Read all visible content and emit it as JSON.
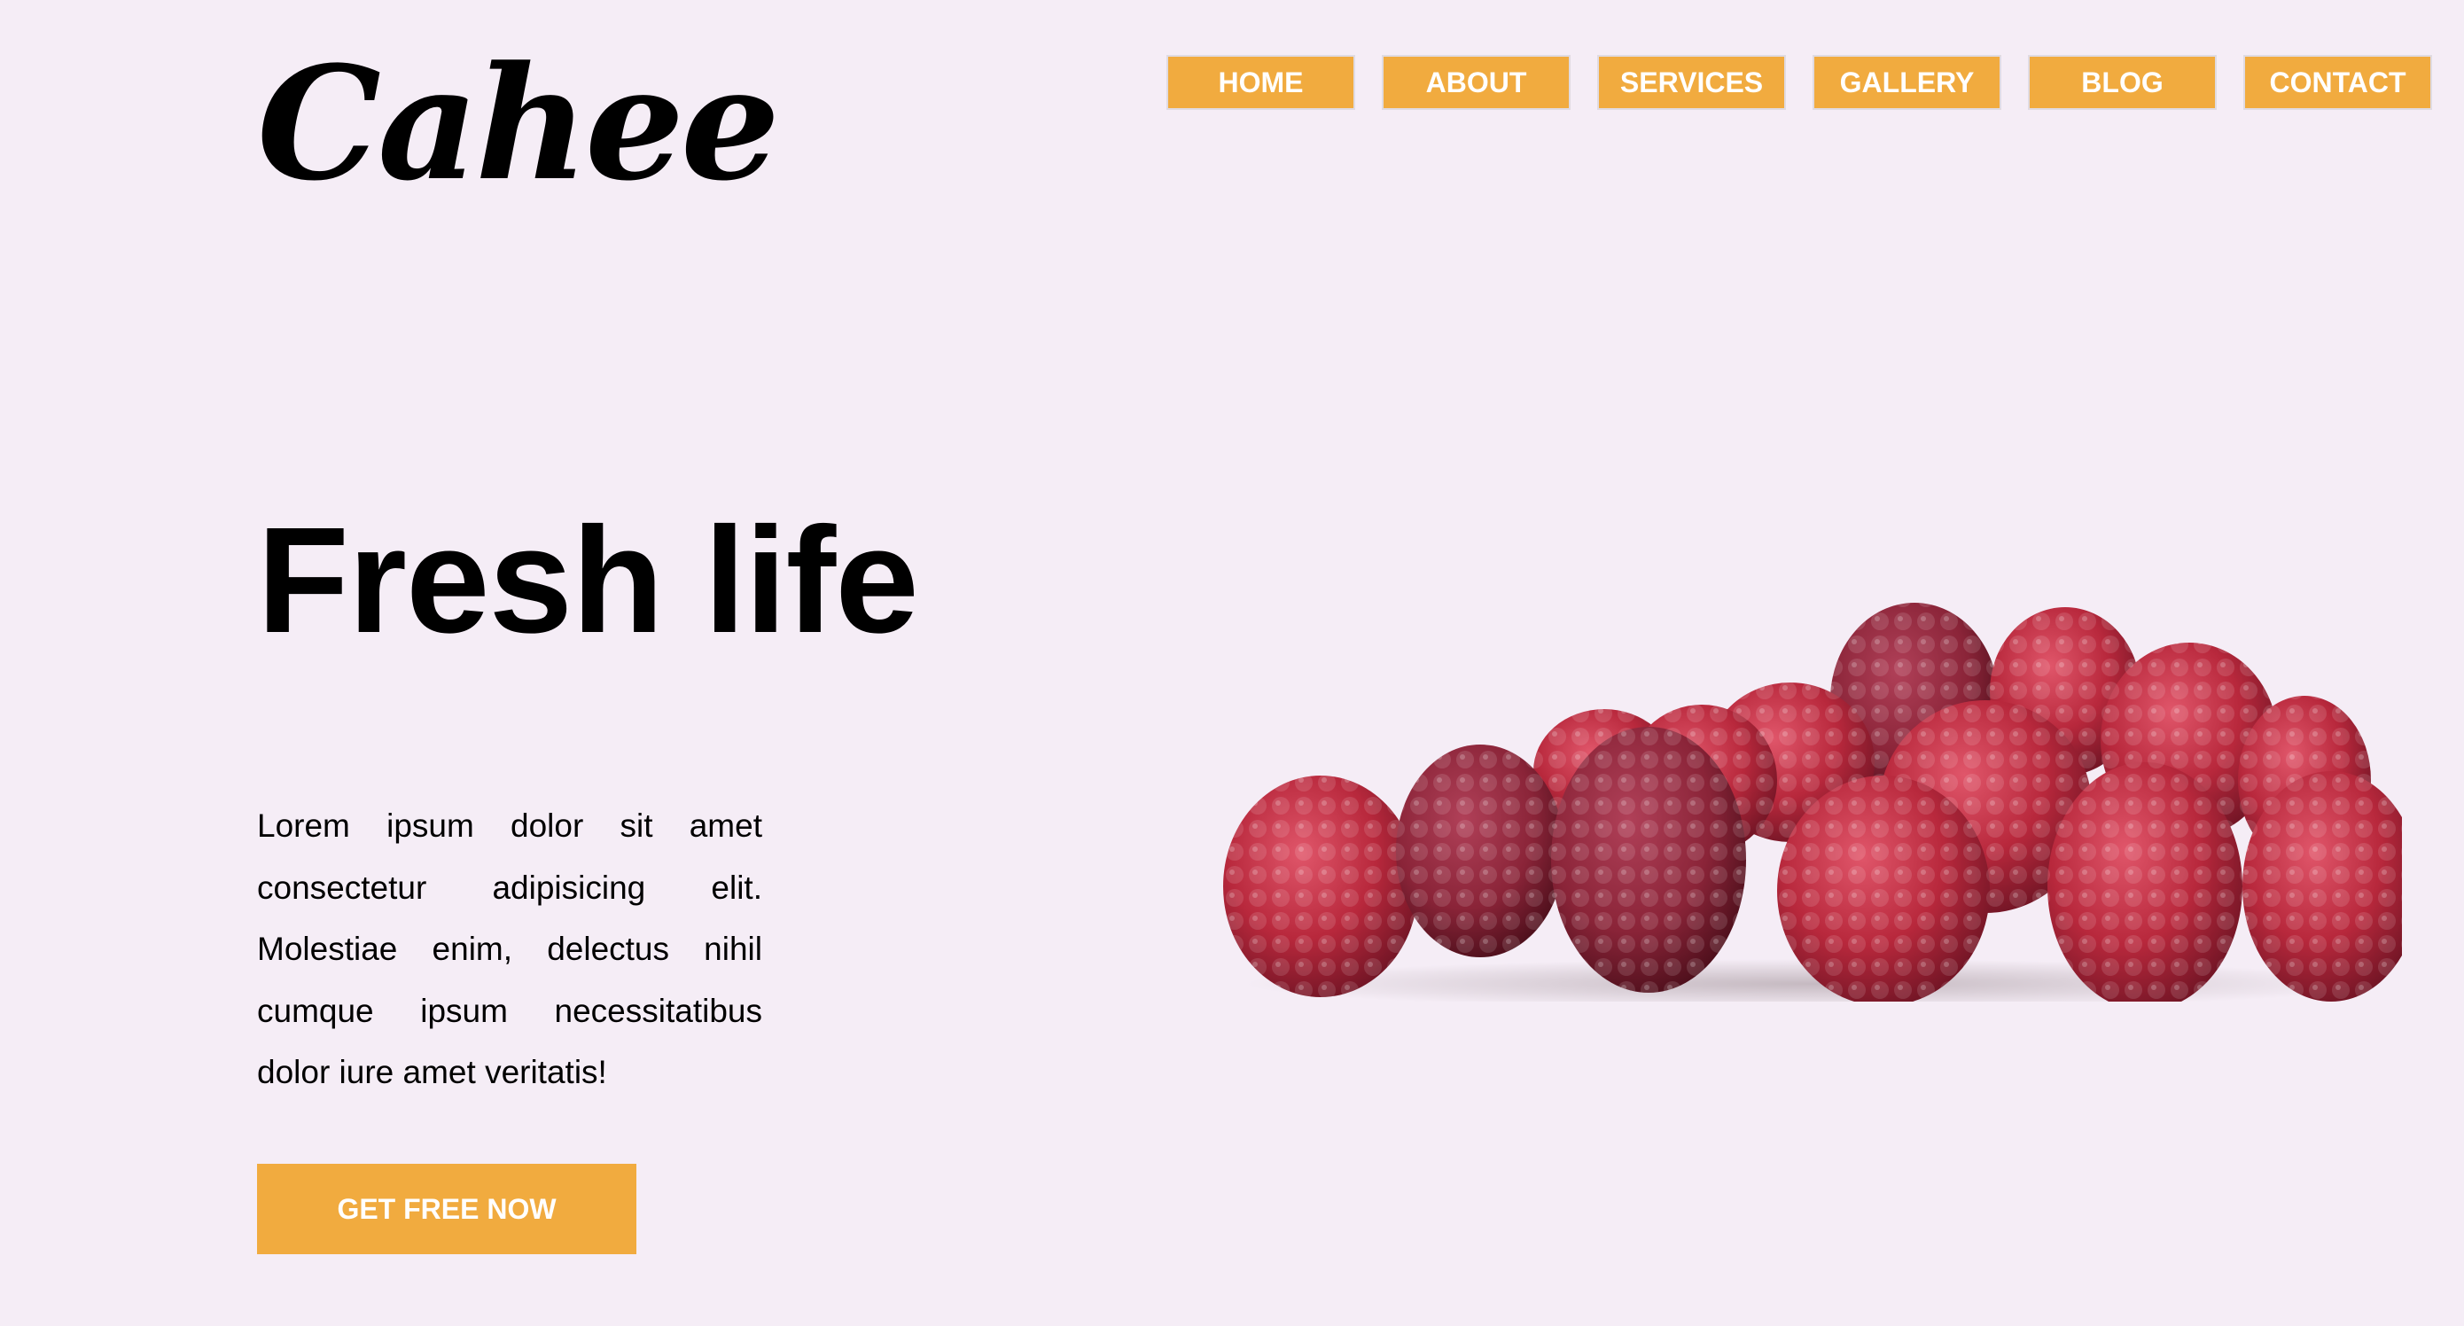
{
  "brand": {
    "logo_text": "Cahee"
  },
  "nav": {
    "items": [
      {
        "label": "HOME"
      },
      {
        "label": "ABOUT"
      },
      {
        "label": "SERVICES"
      },
      {
        "label": "GALLERY"
      },
      {
        "label": "BLOG"
      },
      {
        "label": "CONTACT"
      }
    ]
  },
  "hero": {
    "title": "Fresh life",
    "body": "Lorem ipsum dolor sit amet consectetur adipisicing elit. Molestiae enim, delectus nihil cumque ipsum necessitatibus dolor iure amet veritatis!",
    "cta_label": "GET FREE NOW",
    "image_subject": "raspberries"
  },
  "colors": {
    "background": "#f5edf6",
    "accent": "#f1ab3f",
    "text": "#000000",
    "button_text": "#ffffff",
    "raspberry": "#b8283c"
  }
}
